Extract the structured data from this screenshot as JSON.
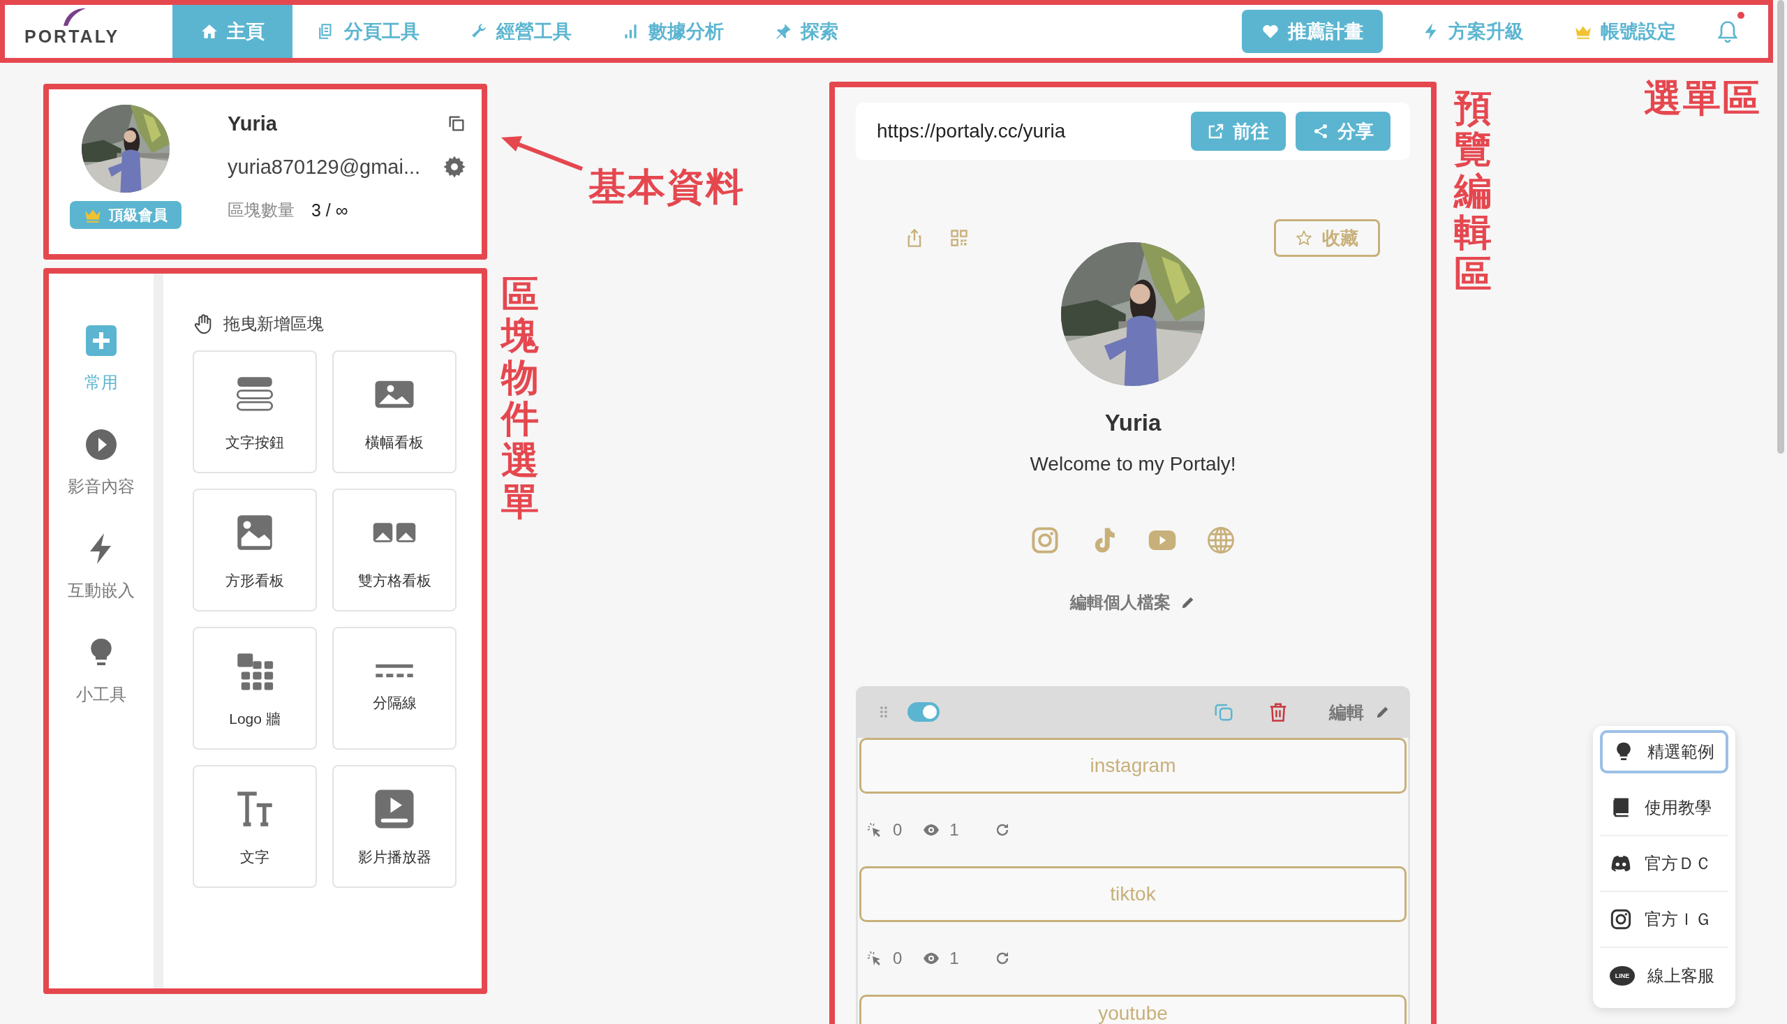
{
  "nav": {
    "logo": "PORTALY",
    "tabs": [
      {
        "label": "主頁",
        "selected": true
      },
      {
        "label": "分頁工具",
        "selected": false
      },
      {
        "label": "經營工具",
        "selected": false
      },
      {
        "label": "數據分析",
        "selected": false
      },
      {
        "label": "探索",
        "selected": false
      }
    ],
    "actions": [
      {
        "label": "推薦計畫",
        "kind": "pill"
      },
      {
        "label": "方案升級",
        "kind": "link"
      },
      {
        "label": "帳號設定",
        "kind": "link"
      }
    ],
    "notifications": {
      "unread": true
    }
  },
  "profile": {
    "name": "Yuria",
    "email": "yuria870129@gmai...",
    "badge": "頂級會員",
    "block_count_label": "區塊數量",
    "block_count": "3 / ∞"
  },
  "palette": {
    "categories": [
      {
        "label": "常用",
        "selected": true
      },
      {
        "label": "影音內容",
        "selected": false
      },
      {
        "label": "互動嵌入",
        "selected": false
      },
      {
        "label": "小工具",
        "selected": false
      }
    ],
    "heading": "拖曳新增區塊",
    "blocks": [
      {
        "label": "文字按鈕"
      },
      {
        "label": "橫幅看板"
      },
      {
        "label": "方形看板"
      },
      {
        "label": "雙方格看板"
      },
      {
        "label": "Logo 牆"
      },
      {
        "label": "分隔線"
      },
      {
        "label": "文字"
      },
      {
        "label": "影片播放器"
      }
    ]
  },
  "preview": {
    "url": "https://portaly.cc/yuria",
    "open_button": "前往",
    "share_button": "分享",
    "favorite_button": "收藏",
    "name": "Yuria",
    "bio": "Welcome to my Portaly!",
    "edit_profile": "編輯個人檔案",
    "block": {
      "on": true,
      "edit": "編輯",
      "links": [
        {
          "label": "instagram",
          "clicks": "0",
          "views": "1"
        },
        {
          "label": "tiktok",
          "clicks": "0",
          "views": "1"
        },
        {
          "label": "youtube"
        }
      ]
    }
  },
  "help_menu": {
    "items": [
      {
        "label": "精選範例",
        "selected": true
      },
      {
        "label": "使用教學",
        "selected": false
      },
      {
        "label": "官方ＤＣ",
        "selected": false
      },
      {
        "label": "官方ＩＧ",
        "selected": false
      },
      {
        "label": "線上客服",
        "selected": false,
        "badge": "LINE"
      }
    ]
  },
  "annotations": [
    {
      "text": "選單區",
      "kind": "horizontal"
    },
    {
      "text": "基本資料",
      "kind": "horizontal"
    },
    {
      "text": "區塊物件選單",
      "kind": "vertical"
    },
    {
      "text": "預覽編輯區",
      "kind": "vertical"
    }
  ]
}
